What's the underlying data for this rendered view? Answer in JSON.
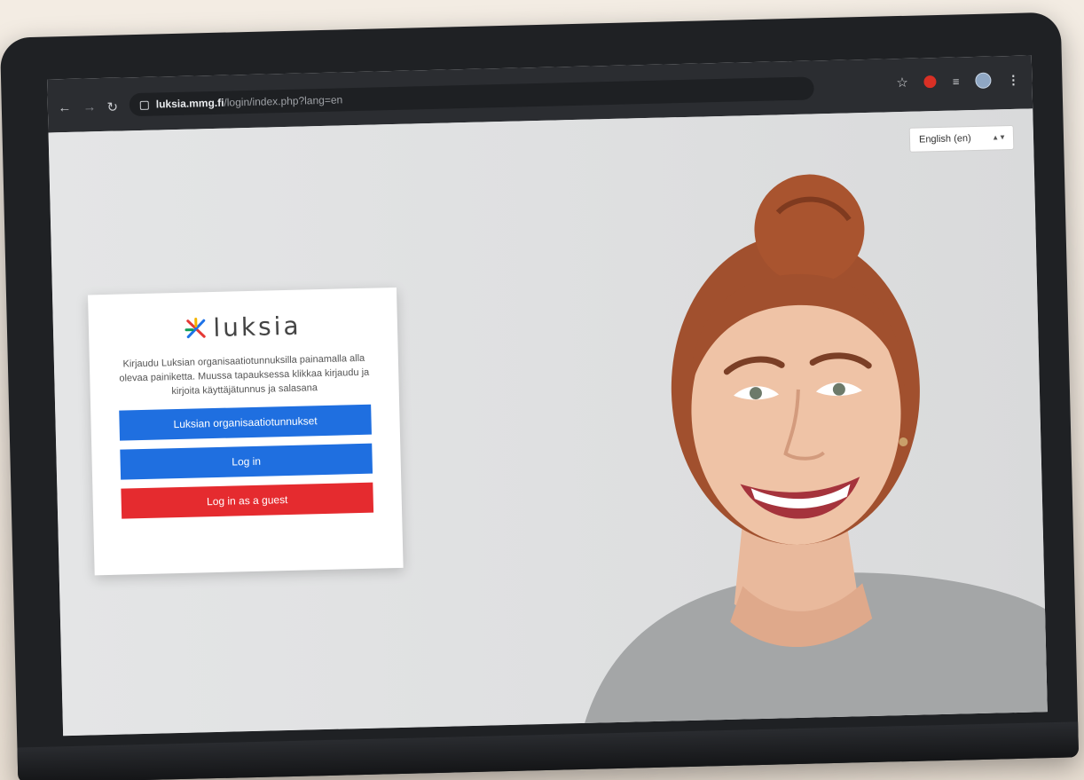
{
  "browser": {
    "url_host": "luksia.mmg.fi",
    "url_path": "/login/index.php?lang=en"
  },
  "language_select": {
    "selected": "English (en)"
  },
  "login_card": {
    "logo_text": "luksia",
    "intro_text": "Kirjaudu Luksian organisaatiotunnuksilla painamalla alla olevaa painiketta. Muussa tapauksessa klikkaa kirjaudu ja kirjoita käyttäjätunnus ja salasana",
    "buttons": {
      "org_login": "Luksian organisaatiotunnukset",
      "login": "Log in",
      "guest_login": "Log in as a guest"
    }
  },
  "colors": {
    "primary_blue": "#1f6fe0",
    "guest_red": "#e52b2f"
  },
  "icons": [
    "back-arrow-icon",
    "forward-arrow-icon",
    "reload-icon",
    "lock-icon",
    "star-icon",
    "extension-icon",
    "cast-icon",
    "profile-avatar",
    "menu-kebab-icon"
  ]
}
